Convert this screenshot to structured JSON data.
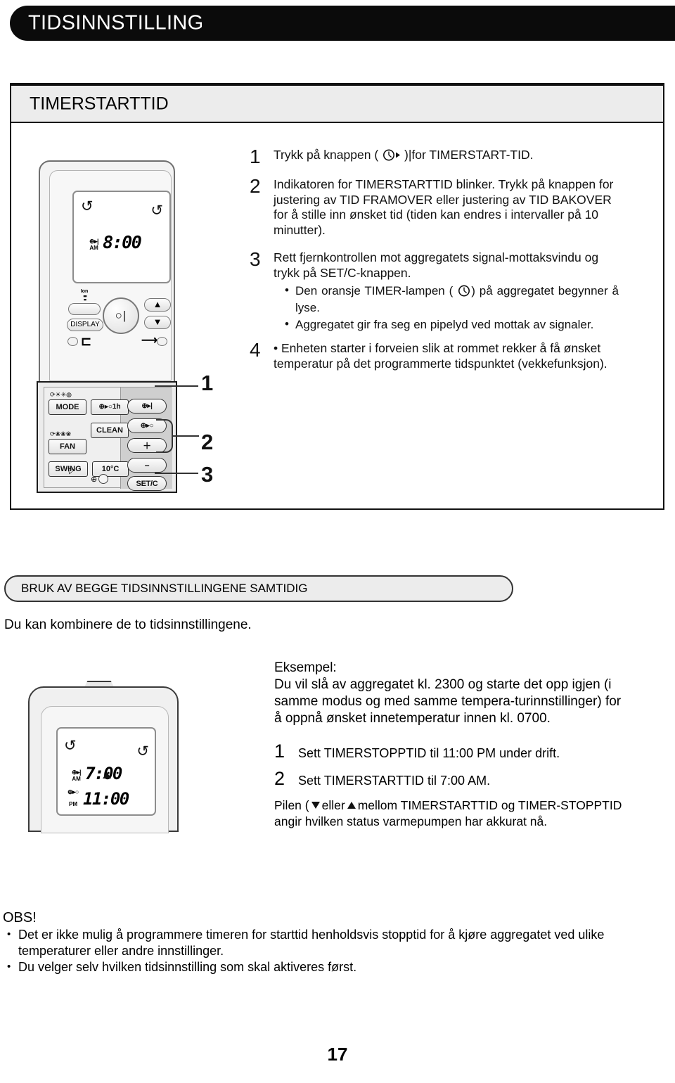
{
  "header": {
    "title": "TIDSINNSTILLING"
  },
  "section1": {
    "subhead": "TIMERSTARTTID",
    "steps": [
      {
        "num": "1",
        "text_before": "Trykk på knappen (",
        "text_after": ")|for TIMERSTART-TID.",
        "icon": "timer-start-icon"
      },
      {
        "num": "2",
        "text": "Indikatoren for TIMERSTARTTID blinker. Trykk på knappen for justering av TID FRAMOVER eller justering av TID BAKOVER for å stille inn ønsket tid (tiden kan endres i intervaller på 10 minutter)."
      },
      {
        "num": "3",
        "text": "Rett fjernkontrollen mot aggregatets signal-mottaksvindu og trykk på SET/C-knappen.",
        "bullets": [
          {
            "before": "Den oransje TIMER-lampen (",
            "after": ") på aggregatet begynner å lyse.",
            "icon": "clock-icon"
          },
          {
            "before": "Aggregatet gir fra seg en pipelyd ved mottak av signaler.",
            "after": "",
            "icon": ""
          }
        ]
      },
      {
        "num": "4",
        "text": "• Enheten starter i forveien slik at rommet rekker å få ønsket temperatur på det programmerte tidspunktet (vekkefunksjon)."
      }
    ],
    "callouts": [
      "1",
      "2",
      "3"
    ]
  },
  "remote1": {
    "lcd": {
      "timer_tag_symbol": "⊕▸|",
      "timer_tag_meridiem": "AM",
      "time": "8:00",
      "swirl_left": "swirl-icon",
      "swirl_right": "swirl-icon"
    },
    "keys": {
      "ion_label": "Ion",
      "display": "DISPLAY",
      "power": "power-button",
      "arrow_up": "▲",
      "arrow_down": "▼",
      "mode": "MODE",
      "timer_1h": "1h",
      "clean": "CLEAN",
      "fan": "FAN",
      "swing": "SWING",
      "temp_10c": "10°C",
      "timer_start": "timer-start-icon",
      "timer_stop": "timer-stop-icon",
      "plus": "＋",
      "minus": "−",
      "set_c": "SET/C"
    },
    "mode_icons": "⟳☀✳◍",
    "fan_icons": "⟳❀❀❀"
  },
  "section2": {
    "pill_heading": "BRUK AV BEGGE TIDSINNSTILLINGENE SAMTIDIG",
    "lead": "Du kan kombinere de to tidsinnstillingene.",
    "example_title": "Eksempel:",
    "example_text": "Du vil slå av aggregatet kl. 2300 og starte det opp igjen (i samme modus og med samme tempera-turinnstillinger) for å oppnå ønsket innetemperatur innen kl. 0700.",
    "steps": [
      {
        "num": "1",
        "text": "Sett TIMERSTOPPTID til 11:00 PM under drift."
      },
      {
        "num": "2",
        "text": "Sett TIMERSTARTTID til 7:00 AM."
      }
    ],
    "arrow_note_before": "Pilen (",
    "arrow_note_mid": "eller",
    "arrow_note_after": "mellom TIMERSTARTTID og TIMER-STOPPTID angir hvilken status varmepumpen har akkurat nå."
  },
  "remote2": {
    "lcd": {
      "swirl_left": "swirl-icon",
      "swirl_right": "swirl-icon",
      "row1_symbol": "⊕▸|",
      "row1_meridiem": "AM",
      "row1_time": "7:00",
      "row2_symbol": "⊕▸○",
      "row2_meridiem": "PM",
      "row2_time": "11:00",
      "indicator_arrow": "up-triangle-icon"
    }
  },
  "obs": {
    "title": "OBS!",
    "items": [
      "Det er ikke mulig å programmere timeren for starttid henholdsvis stopptid for å kjøre aggregatet ved ulike temperaturer eller andre innstillinger.",
      "Du velger selv hvilken tidsinnstilling som skal aktiveres først."
    ]
  },
  "page_number": "17"
}
